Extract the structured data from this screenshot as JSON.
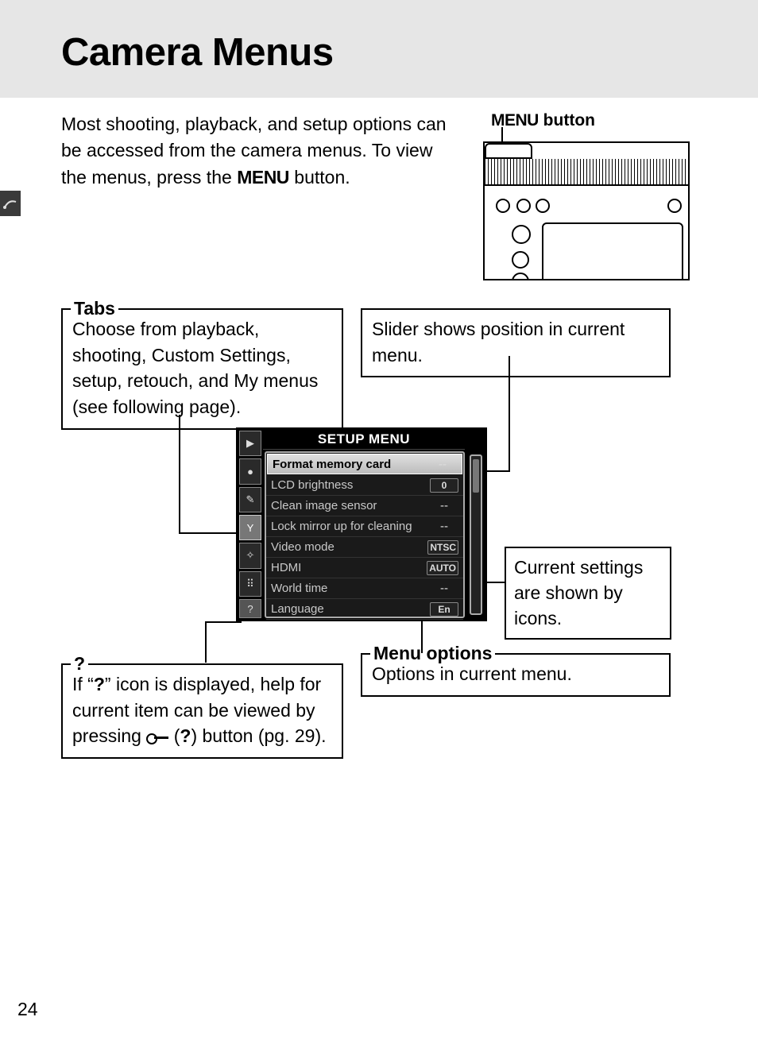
{
  "title": "Camera Menus",
  "intro_before": "Most shooting, playback, and setup options can be accessed from the camera menus.  To view the menus, press the ",
  "intro_menu": "MENU",
  "intro_after": " button.",
  "menu_button_label_prefix": "MENU",
  "menu_button_label_suffix": " button",
  "callouts": {
    "tabs": {
      "label": "Tabs",
      "text": "Choose from playback, shooting, Custom Settings, setup, retouch, and My menus (see following page)."
    },
    "slider": {
      "text": "Slider shows position in current menu."
    },
    "settings": {
      "text": "Current settings are shown by icons."
    },
    "menu_options": {
      "label": "Menu options",
      "text": "Options in current menu."
    },
    "help": {
      "label": "?",
      "text_before": "If “",
      "q": "?",
      "text_mid": "” icon is displayed, help for current item can be viewed by pressing ",
      "paren_q": "?",
      "text_after": ") button (pg. 29)."
    }
  },
  "screen": {
    "title": "SETUP MENU",
    "tabs": [
      "▶",
      "●",
      "✎",
      "Y",
      "✧",
      "⠿",
      "?"
    ],
    "selected_tab_index": 3,
    "items": [
      {
        "name": "Format memory card",
        "value": "--",
        "selected": true,
        "boxed": false
      },
      {
        "name": "LCD brightness",
        "value": "0",
        "selected": false,
        "boxed": true
      },
      {
        "name": "Clean image sensor",
        "value": "--",
        "selected": false,
        "boxed": false
      },
      {
        "name": "Lock mirror up for cleaning",
        "value": "--",
        "selected": false,
        "boxed": false
      },
      {
        "name": "Video mode",
        "value": "NTSC",
        "selected": false,
        "boxed": true
      },
      {
        "name": "HDMI",
        "value": "AUTO",
        "selected": false,
        "boxed": true
      },
      {
        "name": "World time",
        "value": "--",
        "selected": false,
        "boxed": false
      },
      {
        "name": "Language",
        "value": "En",
        "selected": false,
        "boxed": true
      }
    ]
  },
  "page_number": "24"
}
